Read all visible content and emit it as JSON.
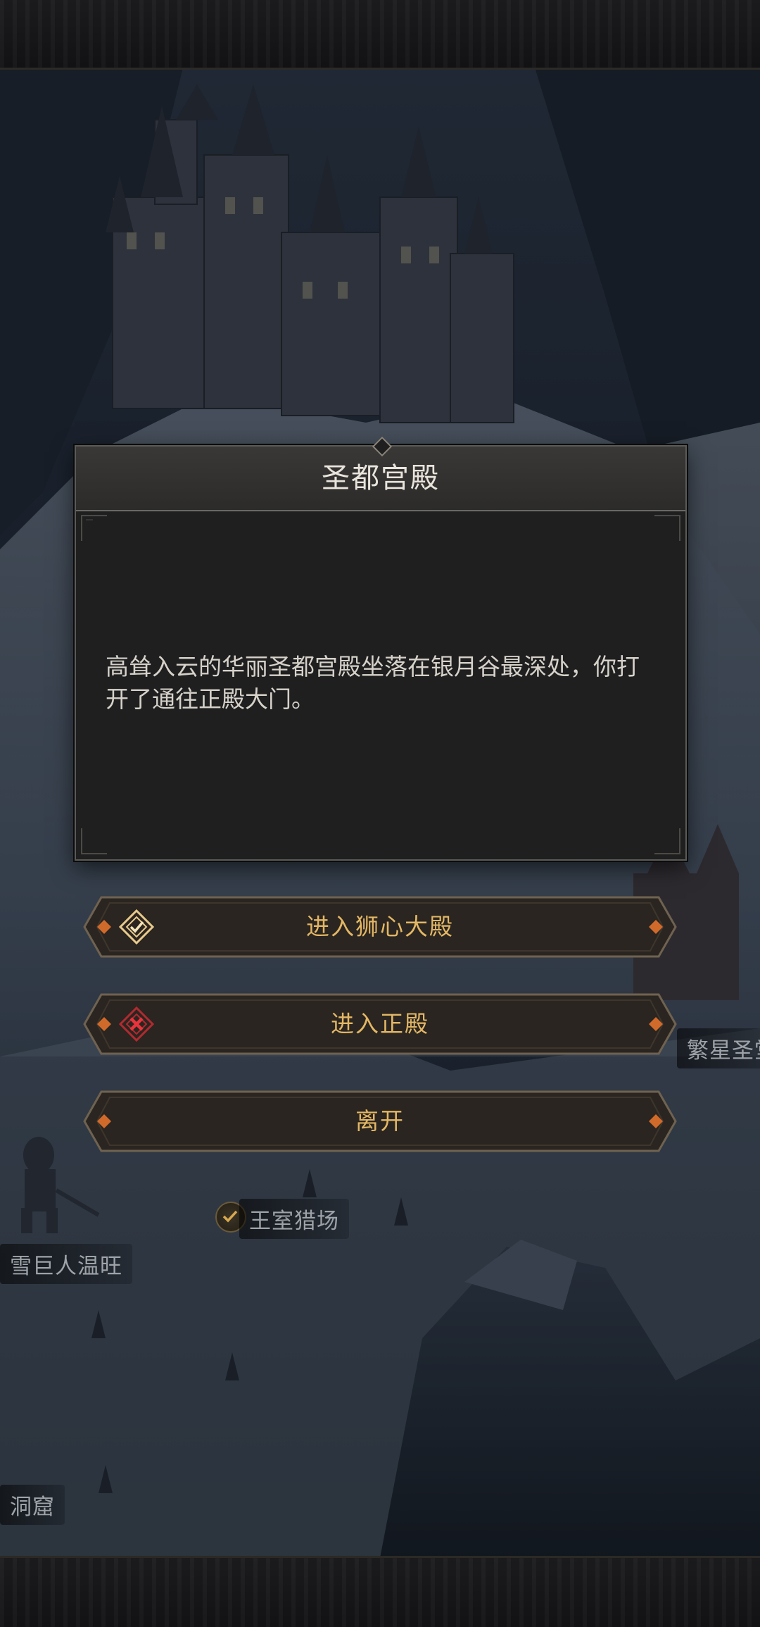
{
  "dialog": {
    "title": "圣都宫殿",
    "body": "高耸入云的华丽圣都宫殿坐落在银月谷最深处，你打开了通往正殿大门。"
  },
  "options": [
    {
      "label": "进入狮心大殿",
      "icon": "check-diamond-icon",
      "status": "available"
    },
    {
      "label": "进入正殿",
      "icon": "cross-diamond-icon",
      "status": "locked"
    },
    {
      "label": "离开",
      "icon": "",
      "status": "available"
    }
  ],
  "map_labels": {
    "royal_hunting_ground": "王室猎场",
    "snow_giant": "雪巨人温旺",
    "star_chapel": "繁星圣堂",
    "cave": "洞窟"
  },
  "colors": {
    "accent_gold": "#e3b765",
    "cross_red": "#d8303a",
    "panel_bg": "#1f1f20"
  }
}
